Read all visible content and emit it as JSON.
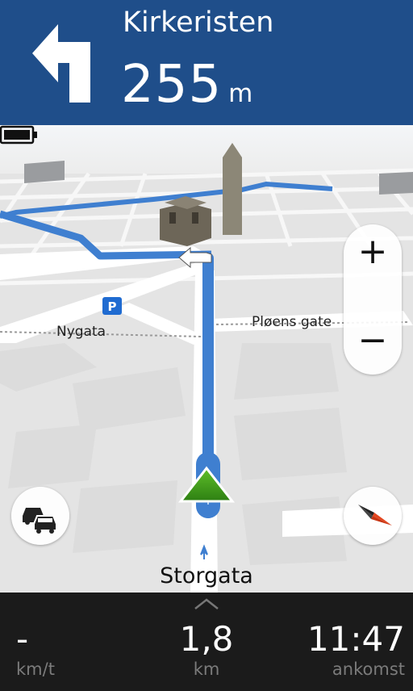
{
  "instruction": {
    "turn_direction": "left",
    "street": "Kirkeristen",
    "distance_value": "255",
    "distance_unit": "m"
  },
  "map": {
    "labels": [
      "Nygata",
      "Pløens gate"
    ],
    "parking_label": "P",
    "current_street": "Storgata"
  },
  "controls": {
    "zoom_in": "+",
    "zoom_out": "−"
  },
  "status_bar": {
    "battery_icon": "battery-icon",
    "speed_value": "-",
    "speed_unit": "km/t",
    "distance_value": "1,8",
    "distance_unit": "km",
    "arrival_value": "11:47",
    "arrival_label": "ankomst"
  },
  "colors": {
    "header_bg": "#1f4e8a",
    "route": "#3f7fd0",
    "position_arrow": "#3d9a1a",
    "bottom_bg": "#1b1b1b"
  }
}
